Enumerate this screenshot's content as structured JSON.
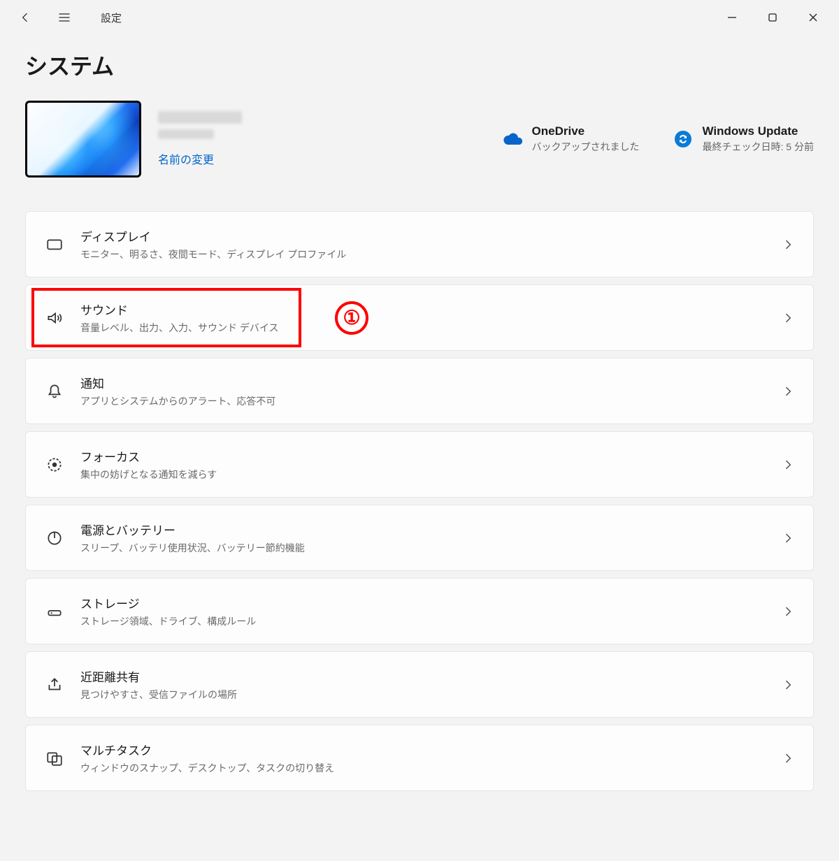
{
  "titlebar": {
    "app_name": "設定"
  },
  "page": {
    "heading": "システム",
    "rename_link": "名前の変更"
  },
  "status": {
    "onedrive": {
      "title": "OneDrive",
      "subtitle": "バックアップされました"
    },
    "update": {
      "title": "Windows Update",
      "subtitle": "最終チェック日時: 5 分前"
    }
  },
  "items": [
    {
      "icon": "display",
      "title": "ディスプレイ",
      "desc": "モニター、明るさ、夜間モード、ディスプレイ プロファイル"
    },
    {
      "icon": "sound",
      "title": "サウンド",
      "desc": "音量レベル、出力、入力、サウンド デバイス"
    },
    {
      "icon": "bell",
      "title": "通知",
      "desc": "アプリとシステムからのアラート、応答不可"
    },
    {
      "icon": "focus",
      "title": "フォーカス",
      "desc": "集中の妨げとなる通知を減らす"
    },
    {
      "icon": "power",
      "title": "電源とバッテリー",
      "desc": "スリープ、バッテリ使用状況、バッテリー節約機能"
    },
    {
      "icon": "storage",
      "title": "ストレージ",
      "desc": "ストレージ領域、ドライブ、構成ルール"
    },
    {
      "icon": "share",
      "title": "近距離共有",
      "desc": "見つけやすさ、受信ファイルの場所"
    },
    {
      "icon": "multitask",
      "title": "マルチタスク",
      "desc": "ウィンドウのスナップ、デスクトップ、タスクの切り替え"
    }
  ],
  "annotation": {
    "highlighted_index": 1,
    "badge_label": "①"
  }
}
